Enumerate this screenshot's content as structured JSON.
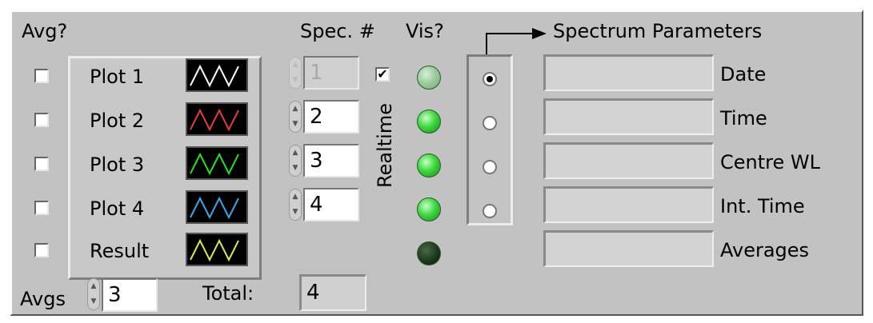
{
  "header": {
    "avg_label": "Avg?",
    "spec_label": "Spec. #",
    "vis_label": "Vis?",
    "spectrum_params_label": "Spectrum Parameters"
  },
  "plots": [
    {
      "label": "Plot 1",
      "color": "#ffffff",
      "avg_checked": false
    },
    {
      "label": "Plot 2",
      "color": "#e83a3a",
      "avg_checked": false
    },
    {
      "label": "Plot 3",
      "color": "#22e022",
      "avg_checked": false
    },
    {
      "label": "Plot 4",
      "color": "#3aa8e8",
      "avg_checked": false
    },
    {
      "label": "Result",
      "color": "#d8e850",
      "avg_checked": false
    }
  ],
  "spec_numbers": [
    {
      "value": "1",
      "disabled": true
    },
    {
      "value": "2",
      "disabled": false
    },
    {
      "value": "3",
      "disabled": false
    },
    {
      "value": "4",
      "disabled": false
    }
  ],
  "realtime": {
    "label": "Realtime",
    "checked": true,
    "mark": "✔"
  },
  "vis_leds": [
    {
      "state": "dim",
      "color": "#90c890"
    },
    {
      "state": "on",
      "color": "#3ed83e"
    },
    {
      "state": "on",
      "color": "#3ed83e"
    },
    {
      "state": "on",
      "color": "#3ed83e"
    },
    {
      "state": "off",
      "color": "#1a3a1a"
    }
  ],
  "radio_selected_index": 0,
  "parameters": [
    {
      "label": "Date",
      "value": ""
    },
    {
      "label": "Time",
      "value": ""
    },
    {
      "label": "Centre WL",
      "value": ""
    },
    {
      "label": "Int. Time",
      "value": ""
    },
    {
      "label": "Averages",
      "value": ""
    }
  ],
  "footer": {
    "avgs_label": "Avgs",
    "avgs_value": "3",
    "total_label": "Total:",
    "total_value": "4"
  },
  "icons": {
    "spin_up": "▲",
    "spin_down": "▼",
    "arrow": "arrow-right-icon"
  }
}
